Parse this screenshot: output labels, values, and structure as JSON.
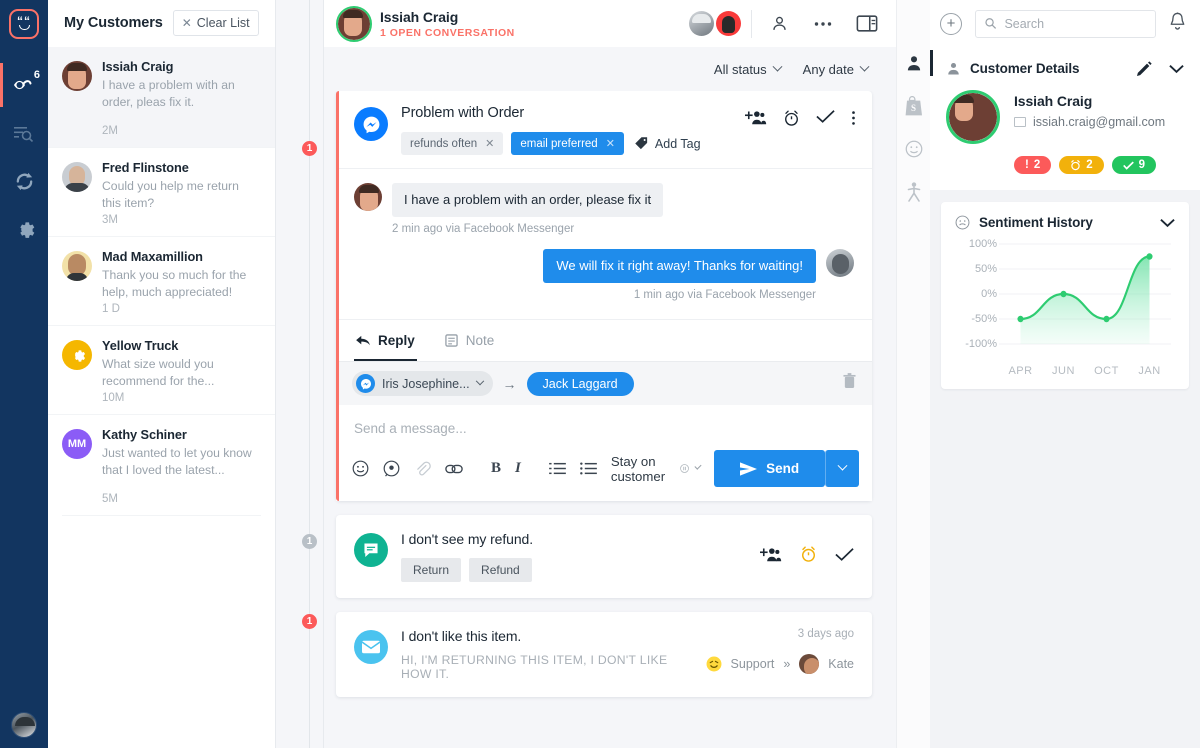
{
  "rail": {
    "logo_name": "acquire-logo",
    "items": [
      {
        "name": "visitors-icon",
        "badge": "6"
      },
      {
        "name": "filter-search-icon",
        "badge": ""
      },
      {
        "name": "sync-icon",
        "badge": ""
      },
      {
        "name": "settings-gear-icon",
        "badge": ""
      }
    ]
  },
  "customers": {
    "title": "My Customers",
    "clear_label": "Clear List",
    "items": [
      {
        "name": "Issiah Craig",
        "snippet": "I have a problem with an order, pleas fix it.",
        "time": "2M"
      },
      {
        "name": "Fred Flinstone",
        "snippet": "Could you help me return this item?",
        "time": "3M"
      },
      {
        "name": "Mad Maxamillion",
        "snippet": "Thank you so much for the help, much appreciated!",
        "time": "1 D"
      },
      {
        "name": "Yellow Truck",
        "snippet": "What size would you recommend for the...",
        "time": "10M"
      },
      {
        "name": "Kathy Schiner",
        "snippet": "Just wanted to let you know that I loved the latest...",
        "time": "5M",
        "initials": "MM"
      }
    ]
  },
  "conversation_header": {
    "name": "Issiah Craig",
    "subtitle": "1 OPEN CONVERSATION",
    "icons": [
      "profile-icon",
      "more-options-icon",
      "panel-toggle-icon"
    ]
  },
  "filters": {
    "status": "All status",
    "date": "Any date"
  },
  "timeline": [
    {
      "badge": "1",
      "color": "red"
    },
    {
      "badge": "1",
      "color": "gray"
    },
    {
      "badge": "1",
      "color": "red"
    }
  ],
  "conversation": {
    "title": "Problem with Order",
    "channel": "facebook-messenger",
    "tags": [
      {
        "label": "refunds often",
        "style": "gray"
      },
      {
        "label": "email preferred",
        "style": "blue"
      }
    ],
    "add_tag_label": "Add Tag",
    "messages": [
      {
        "direction": "in",
        "text": "I have a problem with an order, please fix it",
        "meta": "2 min ago via Facebook Messenger"
      },
      {
        "direction": "out",
        "text": "We will fix it right away! Thanks for waiting!",
        "meta": "1 min ago via Facebook Messenger"
      }
    ]
  },
  "reply": {
    "tab_reply": "Reply",
    "tab_note": "Note",
    "assign_from": "Iris Josephine...",
    "assign_to": "Jack Laggard",
    "placeholder": "Send a message...",
    "stay_label": "Stay on customer",
    "send_label": "Send",
    "toolbar_icons": [
      "emoji-icon",
      "canned-response-icon",
      "attachment-icon",
      "link-icon",
      "bold-icon",
      "italic-icon",
      "ordered-list-icon",
      "bulleted-list-icon"
    ]
  },
  "other_conversations": [
    {
      "title": "I don't see my refund.",
      "channel": "live-chat",
      "buttons": [
        "Return",
        "Refund"
      ]
    },
    {
      "title": "I don't like this item.",
      "channel": "email",
      "preview": "HI, I'M RETURNING THIS ITEM, I DON'T LIKE HOW IT.",
      "time": "3 days ago",
      "department": "Support",
      "agent": "Kate"
    }
  ],
  "right_strip": {
    "items": [
      "customer-profile-icon",
      "shopify-icon",
      "sentiment-icon",
      "visitor-path-icon"
    ]
  },
  "topbar": {
    "search_placeholder": "Search",
    "search_value": ""
  },
  "customer_details": {
    "title": "Customer Details",
    "name": "Issiah Craig",
    "email": "issiah.craig@gmail.com",
    "pills": [
      {
        "icon": "!",
        "value": "2",
        "style": "red"
      },
      {
        "icon": "⏰",
        "value": "2",
        "style": "amber"
      },
      {
        "icon": "✓",
        "value": "9",
        "style": "green"
      }
    ]
  },
  "chart_data": {
    "type": "area",
    "title": "Sentiment History",
    "categories": [
      "APR",
      "JUN",
      "OCT",
      "JAN"
    ],
    "values": [
      -50,
      0,
      -50,
      75
    ],
    "ylabels": [
      "100%",
      "50%",
      "0%",
      "-50%",
      "-100%"
    ],
    "ylim": [
      -100,
      100
    ],
    "xlabel": "",
    "ylabel": "",
    "grid": true,
    "legend": "none",
    "line_color": "#2ecc71",
    "fill_color": "#9ae8be"
  },
  "colors": {
    "brand_navy": "#123560",
    "accent_red": "#fa7268",
    "accent_blue": "#1f8ceb",
    "green": "#2ecc71"
  }
}
